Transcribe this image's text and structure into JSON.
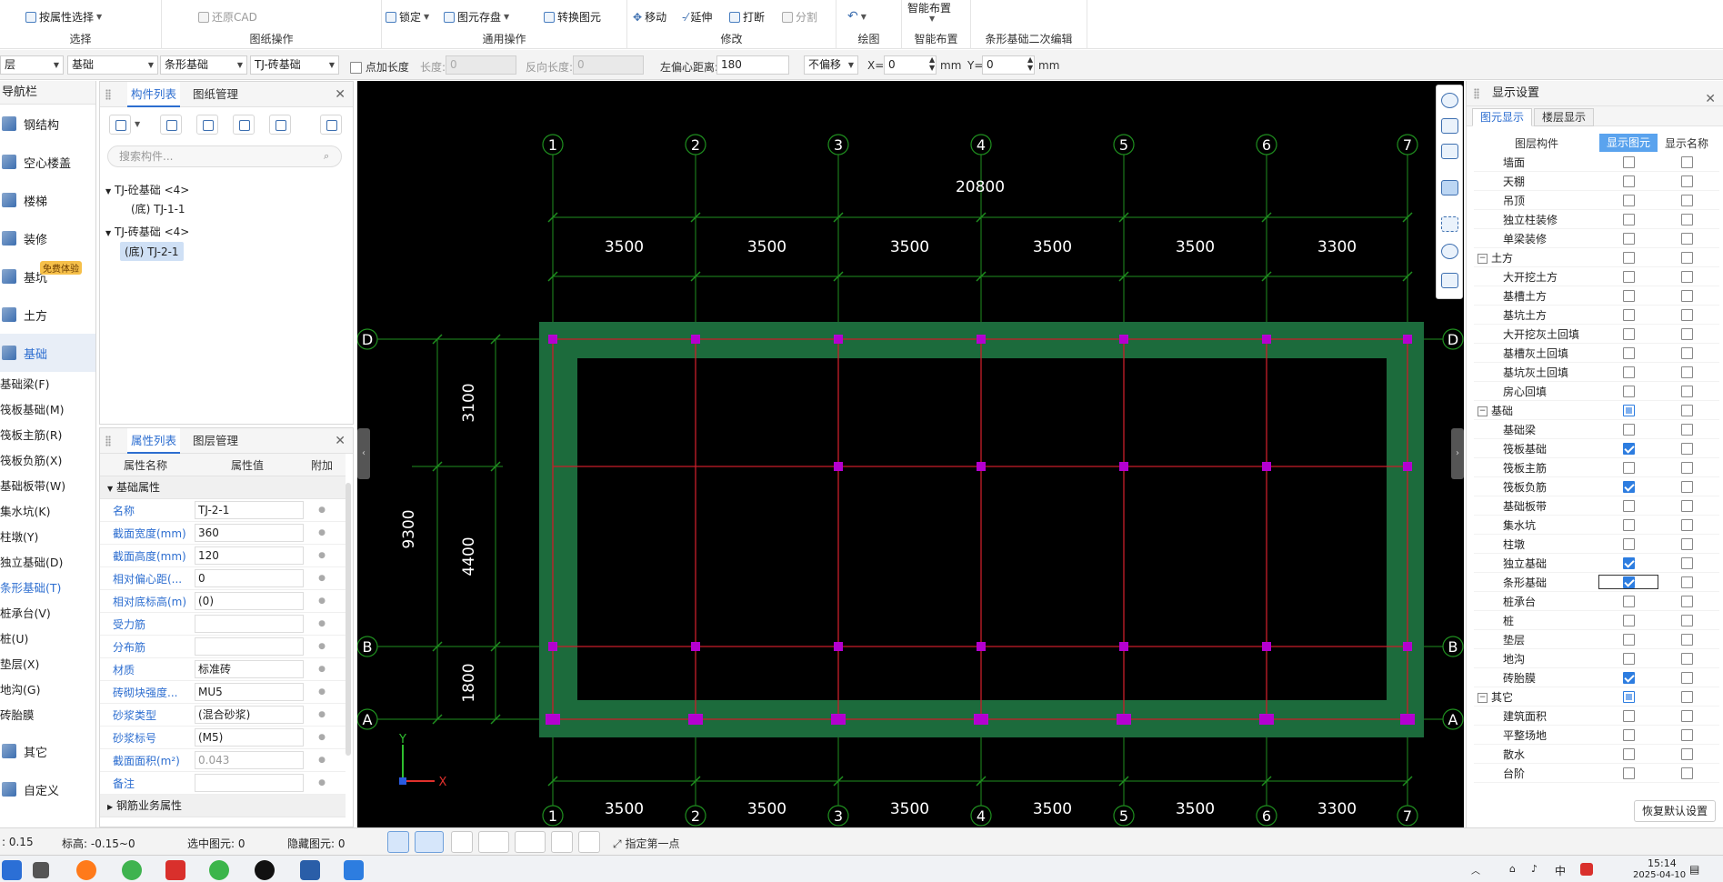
{
  "ribbon": {
    "groups": [
      {
        "id": "select",
        "label": "选择",
        "buttons": [
          "按属性选择"
        ]
      },
      {
        "id": "drawing",
        "label": "图纸操作",
        "buttons": [
          "还原CAD"
        ]
      },
      {
        "id": "general",
        "label": "通用操作",
        "buttons": [
          "锁定",
          "图元存盘",
          "转换图元"
        ]
      },
      {
        "id": "modify",
        "label": "修改",
        "buttons": [
          "移动",
          "延伸",
          "打断",
          "分割"
        ]
      },
      {
        "id": "draw",
        "label": "绘图",
        "buttons": []
      },
      {
        "id": "smart",
        "label": "智能布置",
        "buttons": [
          "智能布置"
        ]
      },
      {
        "id": "strip",
        "label": "条形基础二次编辑",
        "buttons": []
      }
    ]
  },
  "propbar": {
    "combo_layer": "层",
    "combo_category": "基础",
    "combo_type": "条形基础",
    "combo_member": "TJ-砖基础",
    "add_length_label": "点加长度",
    "length_label": "长度:",
    "length_value": "0",
    "reverse_length_label": "反向长度:",
    "reverse_length_value": "0",
    "left_offset_label": "左偏心距离:",
    "left_offset_value": "180",
    "offset_mode": "不偏移",
    "x_label": "X=",
    "x_value": "0",
    "y_label": "Y=",
    "y_value": "0",
    "unit": "mm"
  },
  "nav": {
    "title": "导航栏",
    "items": [
      {
        "label": "钢结构",
        "sel": false
      },
      {
        "label": "空心楼盖",
        "sel": false
      },
      {
        "label": "楼梯",
        "sel": false
      },
      {
        "label": "装修",
        "sel": false
      },
      {
        "label": "基坑",
        "sel": false,
        "badge": "免费体验"
      },
      {
        "label": "土方",
        "sel": false
      },
      {
        "label": "基础",
        "sel": true
      }
    ],
    "subitems": [
      {
        "label": "基础梁(F)",
        "sel": false
      },
      {
        "label": "筏板基础(M)",
        "sel": false
      },
      {
        "label": "筏板主筋(R)",
        "sel": false
      },
      {
        "label": "筏板负筋(X)",
        "sel": false
      },
      {
        "label": "基础板带(W)",
        "sel": false
      },
      {
        "label": "集水坑(K)",
        "sel": false
      },
      {
        "label": "柱墩(Y)",
        "sel": false
      },
      {
        "label": "独立基础(D)",
        "sel": false
      },
      {
        "label": "条形基础(T)",
        "sel": true
      },
      {
        "label": "桩承台(V)",
        "sel": false
      },
      {
        "label": "桩(U)",
        "sel": false
      },
      {
        "label": "垫层(X)",
        "sel": false
      },
      {
        "label": "地沟(G)",
        "sel": false
      },
      {
        "label": "砖胎膜",
        "sel": false
      }
    ],
    "bottom": [
      {
        "label": "其它"
      },
      {
        "label": "自定义"
      }
    ]
  },
  "components": {
    "tabs": [
      "构件列表",
      "图纸管理"
    ],
    "search_placeholder": "搜索构件...",
    "tree": [
      {
        "label": "TJ-砼基础 <4>",
        "children": [
          "(底) TJ-1-1"
        ]
      },
      {
        "label": "TJ-砖基础 <4>",
        "children": [
          "(底) TJ-2-1"
        ]
      }
    ]
  },
  "properties": {
    "tabs": [
      "属性列表",
      "图层管理"
    ],
    "headers": [
      "属性名称",
      "属性值",
      "附加"
    ],
    "group": "基础属性",
    "rows": [
      {
        "name": "名称",
        "value": "TJ-2-1",
        "dis": false
      },
      {
        "name": "截面宽度(mm)",
        "value": "360",
        "dis": false
      },
      {
        "name": "截面高度(mm)",
        "value": "120",
        "dis": false
      },
      {
        "name": "相对偏心距(...",
        "value": "0",
        "dis": false
      },
      {
        "name": "相对底标高(m)",
        "value": "(0)",
        "dis": false
      },
      {
        "name": "受力筋",
        "value": "",
        "dis": false
      },
      {
        "name": "分布筋",
        "value": "",
        "dis": false
      },
      {
        "name": "材质",
        "value": "标准砖",
        "dis": false
      },
      {
        "name": "砖砌块强度...",
        "value": "MU5",
        "dis": false
      },
      {
        "name": "砂浆类型",
        "value": "(混合砂浆)",
        "dis": false
      },
      {
        "name": "砂浆标号",
        "value": "(M5)",
        "dis": false
      },
      {
        "name": "截面面积(m²)",
        "value": "0.043",
        "dis": true
      },
      {
        "name": "备注",
        "value": "",
        "dis": false
      }
    ],
    "footer_group": "钢筋业务属性"
  },
  "drawing": {
    "total_x": "20800",
    "spans_x": [
      "3500",
      "3500",
      "3500",
      "3500",
      "3500",
      "3300"
    ],
    "axes_x": [
      "1",
      "2",
      "3",
      "4",
      "5",
      "6",
      "7"
    ],
    "axes_y": [
      "D",
      "B",
      "A"
    ],
    "total_y": "9300",
    "spans_y": [
      "3100",
      "4400",
      "1800"
    ],
    "axis_x_label": "X",
    "axis_y_label": "Y"
  },
  "display": {
    "title": "显示设置",
    "tabs": [
      "图元显示",
      "楼层显示"
    ],
    "headers": [
      "图层构件",
      "显示图元",
      "显示名称"
    ],
    "rows": [
      {
        "type": "itm",
        "label": "墙面",
        "c1": false,
        "c2": false
      },
      {
        "type": "itm",
        "label": "天棚",
        "c1": false,
        "c2": false
      },
      {
        "type": "itm",
        "label": "吊顶",
        "c1": false,
        "c2": false
      },
      {
        "type": "itm",
        "label": "独立柱装修",
        "c1": false,
        "c2": false
      },
      {
        "type": "itm",
        "label": "单梁装修",
        "c1": false,
        "c2": false
      },
      {
        "type": "grp",
        "label": "土方",
        "c1": false,
        "c2": false
      },
      {
        "type": "itm",
        "label": "大开挖土方",
        "c1": false,
        "c2": false
      },
      {
        "type": "itm",
        "label": "基槽土方",
        "c1": false,
        "c2": false
      },
      {
        "type": "itm",
        "label": "基坑土方",
        "c1": false,
        "c2": false
      },
      {
        "type": "itm",
        "label": "大开挖灰土回填",
        "c1": false,
        "c2": false
      },
      {
        "type": "itm",
        "label": "基槽灰土回填",
        "c1": false,
        "c2": false
      },
      {
        "type": "itm",
        "label": "基坑灰土回填",
        "c1": false,
        "c2": false
      },
      {
        "type": "itm",
        "label": "房心回填",
        "c1": false,
        "c2": false
      },
      {
        "type": "grp",
        "label": "基础",
        "c1": "part",
        "c2": false
      },
      {
        "type": "itm",
        "label": "基础梁",
        "c1": false,
        "c2": false
      },
      {
        "type": "itm",
        "label": "筏板基础",
        "c1": true,
        "c2": false
      },
      {
        "type": "itm",
        "label": "筏板主筋",
        "c1": false,
        "c2": false
      },
      {
        "type": "itm",
        "label": "筏板负筋",
        "c1": true,
        "c2": false
      },
      {
        "type": "itm",
        "label": "基础板带",
        "c1": false,
        "c2": false
      },
      {
        "type": "itm",
        "label": "集水坑",
        "c1": false,
        "c2": false
      },
      {
        "type": "itm",
        "label": "柱墩",
        "c1": false,
        "c2": false
      },
      {
        "type": "itm",
        "label": "独立基础",
        "c1": true,
        "c2": false
      },
      {
        "type": "itm",
        "label": "条形基础",
        "c1": true,
        "c2": false,
        "focus": true
      },
      {
        "type": "itm",
        "label": "桩承台",
        "c1": false,
        "c2": false
      },
      {
        "type": "itm",
        "label": "桩",
        "c1": false,
        "c2": false
      },
      {
        "type": "itm",
        "label": "垫层",
        "c1": false,
        "c2": false
      },
      {
        "type": "itm",
        "label": "地沟",
        "c1": false,
        "c2": false
      },
      {
        "type": "itm",
        "label": "砖胎膜",
        "c1": true,
        "c2": false
      },
      {
        "type": "grp",
        "label": "其它",
        "c1": "part",
        "c2": false
      },
      {
        "type": "itm",
        "label": "建筑面积",
        "c1": false,
        "c2": false
      },
      {
        "type": "itm",
        "label": "平整场地",
        "c1": false,
        "c2": false
      },
      {
        "type": "itm",
        "label": "散水",
        "c1": false,
        "c2": false
      },
      {
        "type": "itm",
        "label": "台阶",
        "c1": false,
        "c2": false
      }
    ],
    "restore_button": "恢复默认设置"
  },
  "status": {
    "scale": "0.15",
    "elev_label": "标高:",
    "elev_value": "-0.15~0",
    "selected_label": "选中图元:",
    "selected_value": "0",
    "hidden_label": "隐藏图元:",
    "hidden_value": "0",
    "hint": "指定第一点"
  },
  "taskbar": {
    "ime": "中",
    "time": "15:14",
    "date": "2025-04-10"
  },
  "colors": {
    "grid": "#1f8f1f",
    "foundation": "#1c6b3c",
    "axis_red": "#c81e2a",
    "node": "#b400d0",
    "accent": "#2d6ed0"
  }
}
